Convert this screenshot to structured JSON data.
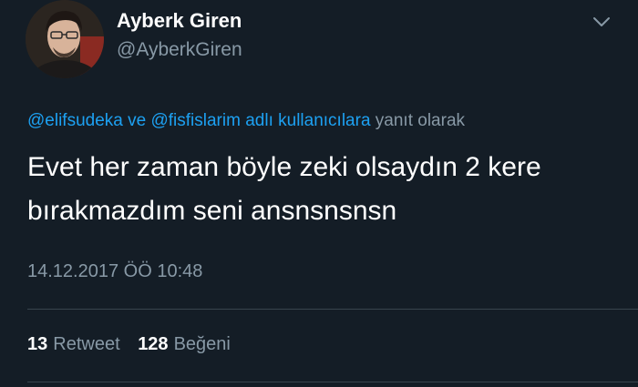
{
  "user": {
    "display_name": "Ayberk Giren",
    "handle": "@AyberkGiren"
  },
  "reply": {
    "mention_1": "@elifsudeka",
    "connector": "ve",
    "mention_2": "@fisfislarim",
    "users_label": "adlı kullanıcılara",
    "suffix": "yanıt olarak"
  },
  "tweet": {
    "text": "Evet her zaman böyle zeki olsaydın 2 kere bırakmazdım seni ansnsnsnsn",
    "timestamp": "14.12.2017 ÖÖ 10:48"
  },
  "stats": {
    "retweets_count": "13",
    "retweets_label": "Retweet",
    "likes_count": "128",
    "likes_label": "Beğeni"
  },
  "icons": {
    "caret": "chevron-down-icon"
  },
  "colors": {
    "background": "#141d26",
    "link": "#1da1f2",
    "muted": "#8899a6",
    "divider": "#38444d"
  }
}
